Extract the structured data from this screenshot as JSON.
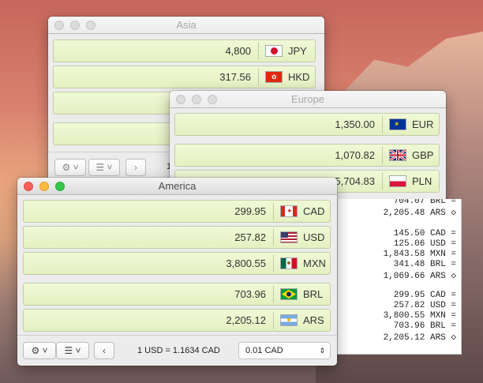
{
  "asia": {
    "title": "Asia",
    "rows": [
      {
        "amount": "4,800",
        "code": "JPY",
        "flag": "japan-flag"
      },
      {
        "amount": "317.56",
        "code": "HKD",
        "flag": "hong-kong-flag"
      },
      {
        "amount": "",
        "code": "",
        "flag": ""
      },
      {
        "amount": "",
        "code": "",
        "flag": ""
      }
    ],
    "partial_rate": "1"
  },
  "europe": {
    "title": "Europe",
    "rows": [
      {
        "amount": "1,350.00",
        "code": "EUR",
        "flag": "eu-flag"
      },
      {
        "amount": "1,070.82",
        "code": "GBP",
        "flag": "uk-flag"
      },
      {
        "amount": "5,704.83",
        "code": "PLN",
        "flag": "poland-flag"
      }
    ]
  },
  "america": {
    "title": "America",
    "rows": [
      {
        "amount": "299.95",
        "code": "CAD",
        "flag": "canada-flag"
      },
      {
        "amount": "257.82",
        "code": "USD",
        "flag": "usa-flag"
      },
      {
        "amount": "3,800.55",
        "code": "MXN",
        "flag": "mexico-flag"
      },
      {
        "amount": "703.96",
        "code": "BRL",
        "flag": "brazil-flag"
      },
      {
        "amount": "2,205.12",
        "code": "ARS",
        "flag": "argentina-flag"
      }
    ],
    "rate_text": "1 USD = 1.1634 CAD",
    "precision_select": "0.01 CAD"
  },
  "list_lines": [
    "704.07 BRL =",
    "2,205.48 ARS ◇",
    "",
    "145.50 CAD =",
    "125.06 USD =",
    "1,843.58 MXN =",
    "341.48 BRL =",
    "1,069.66 ARS ◇",
    "",
    "299.95 CAD =",
    "257.82 USD =",
    "3,800.55 MXN =",
    "703.96 BRL =",
    "2,205.12 ARS ◇"
  ],
  "colors": {
    "row_bg": "#e9f4c9",
    "accent_red": "#fc605c"
  }
}
